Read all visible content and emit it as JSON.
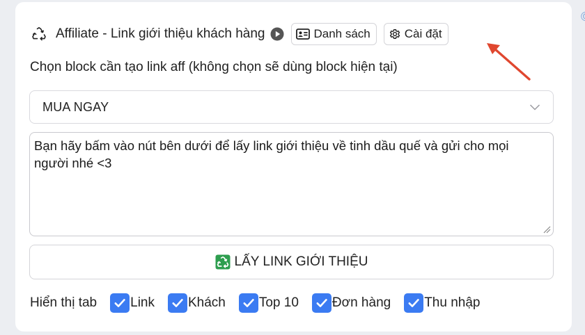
{
  "header": {
    "title": "Affiliate - Link giới thiệu khách hàng",
    "icon": "recycle-icon",
    "play_icon": "play-icon",
    "list_button": "Danh sách",
    "settings_button": "Cài đặt"
  },
  "block_select": {
    "label": "Chọn block cần tạo link aff (không chọn sẽ dùng block hiện tại)",
    "value": "MUA NGAY"
  },
  "message": {
    "text": "Bạn hãy bấm vào nút bên dưới để lấy link giới thiệu về tinh dầu quế và gửi cho mọi người nhé <3"
  },
  "get_link_button": "LẤY LINK GIỚI THIỆU",
  "tabs": {
    "label": "Hiển thị tab",
    "items": [
      {
        "label": "Link",
        "checked": true
      },
      {
        "label": "Khách",
        "checked": true
      },
      {
        "label": "Top 10",
        "checked": true
      },
      {
        "label": "Đơn hàng",
        "checked": true
      },
      {
        "label": "Thu nhập",
        "checked": true
      }
    ]
  },
  "colors": {
    "checkbox": "#3b7bf2",
    "annotation_arrow": "#e0472f",
    "recycle_green": "#2e9e4f"
  }
}
